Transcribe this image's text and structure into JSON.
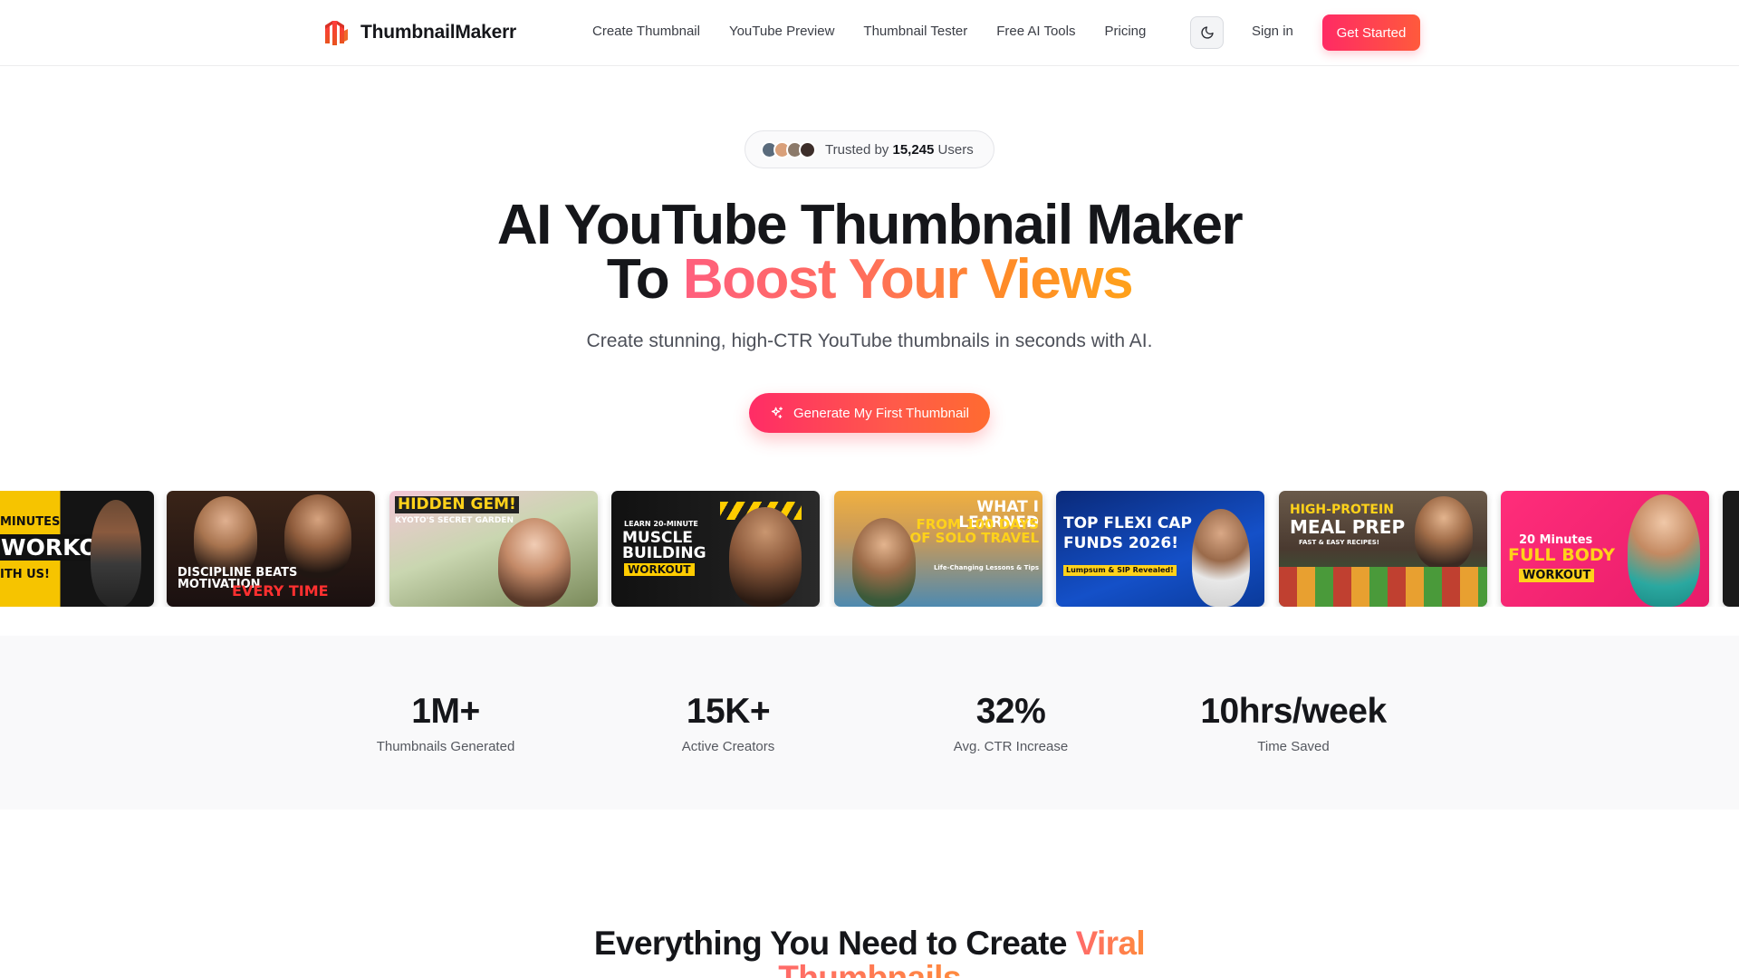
{
  "header": {
    "brand": "ThumbnailMakerr",
    "nav": [
      "Create Thumbnail",
      "YouTube Preview",
      "Thumbnail Tester",
      "Free AI Tools",
      "Pricing"
    ],
    "signin": "Sign in",
    "get_started": "Get Started",
    "theme_icon": "moon-icon",
    "logo_icon": "thumbnail-makerr-logo"
  },
  "hero": {
    "trusted_prefix": "Trusted by",
    "trusted_count": "15,245",
    "trusted_suffix": "Users",
    "title_line1": "AI YouTube Thumbnail Maker",
    "title_line2_prefix": "To",
    "title_line2_highlight": "Boost Your Views",
    "subtitle": "Create stunning, high-CTR YouTube thumbnails in seconds with AI.",
    "cta": "Generate My First Thumbnail",
    "cta_icon": "sparkles-icon"
  },
  "thumbnails": [
    {
      "text1": "MINUTES",
      "text2": "WORKOUT",
      "text3": "ITH US!"
    },
    {
      "text1": "DISCIPLINE BEATS MOTIVATION",
      "text2": "EVERY TIME"
    },
    {
      "text1": "HIDDEN GEM!",
      "text2": "KYOTO'S SECRET GARDEN"
    },
    {
      "text1": "LEARN 20-MINUTE",
      "text2": "MUSCLE BUILDING",
      "text3": "WORKOUT"
    },
    {
      "text1": "WHAT I LEARNED",
      "text2": "FROM 100 DAYS OF SOLO TRAVEL",
      "text3": "Life-Changing Lessons & Tips"
    },
    {
      "text1": "TOP FLEXI CAP",
      "text2": "FUNDS 2026!",
      "text3": "Lumpsum & SIP Revealed!"
    },
    {
      "text1": "HIGH-PROTEIN",
      "text2": "MEAL PREP",
      "text3": "FAST & EASY RECIPES!"
    },
    {
      "text1": "20 Minutes",
      "text2": "FULL BODY",
      "text3": "WORKOUT"
    }
  ],
  "stats": [
    {
      "value": "1M+",
      "label": "Thumbnails Generated"
    },
    {
      "value": "15K+",
      "label": "Active Creators"
    },
    {
      "value": "32%",
      "label": "Avg. CTR Increase"
    },
    {
      "value": "10hrs/week",
      "label": "Time Saved"
    }
  ],
  "features": {
    "title_prefix": "Everything You Need to Create",
    "title_highlight_1": "Viral",
    "title_highlight_2": "Thumbnails"
  },
  "colors": {
    "brand_red": "#ff2a64",
    "brand_orange": "#ff6b30",
    "accent_yellow": "#ffa11a"
  }
}
